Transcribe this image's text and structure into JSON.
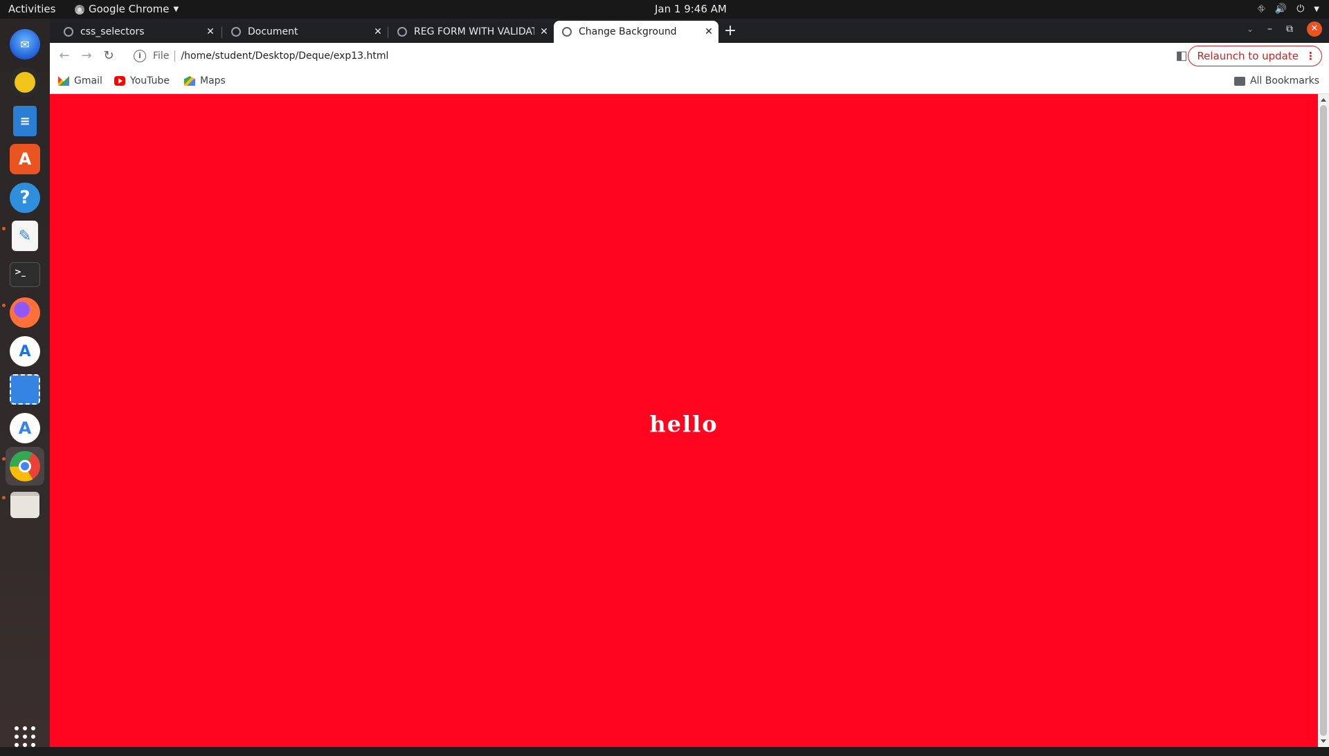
{
  "topbar": {
    "activities": "Activities",
    "app_name": "Google Chrome",
    "clock": "Jan 1  9:46 AM"
  },
  "dock": {
    "apps": [
      {
        "icon": "thunderbird-icon",
        "color": "#1f6feb"
      },
      {
        "icon": "rhythmbox-icon",
        "color": "#e5a50a"
      },
      {
        "icon": "libreoffice-writer-icon",
        "color": "#2a7fd4"
      },
      {
        "icon": "ubuntu-software-icon",
        "color": "#e95420"
      },
      {
        "icon": "help-icon",
        "color": "#2f8fdc"
      },
      {
        "icon": "text-editor-icon",
        "color": "#f5f5f5"
      },
      {
        "icon": "terminal-icon",
        "color": "#2d2d2d"
      },
      {
        "icon": "firefox-icon",
        "color": "#ff7139"
      },
      {
        "icon": "android-studio-icon",
        "color": "#ffffff"
      },
      {
        "icon": "screenshot-icon",
        "color": "#3584e4"
      },
      {
        "icon": "app-center-icon",
        "color": "#ffffff"
      },
      {
        "icon": "chrome-icon",
        "color": "#4285f4"
      },
      {
        "icon": "files-icon",
        "color": "#d7d3cd"
      },
      {
        "icon": "show-apps-icon",
        "color": "#ffffff"
      }
    ]
  },
  "tabs": [
    {
      "title": "css_selectors",
      "active": false
    },
    {
      "title": "Document",
      "active": false
    },
    {
      "title": "REG FORM WITH VALIDAT",
      "active": false
    },
    {
      "title": "Change Background",
      "active": true
    }
  ],
  "toolbar": {
    "scheme": "File",
    "url": "/home/student/Desktop/Deque/exp13.html",
    "relaunch_label": "Relaunch to update"
  },
  "bookmarks": {
    "items": [
      "Gmail",
      "YouTube",
      "Maps"
    ],
    "all_label": "All Bookmarks"
  },
  "page": {
    "background_color": "#ff0520",
    "text": "hello",
    "text_color": "#ffffff"
  }
}
